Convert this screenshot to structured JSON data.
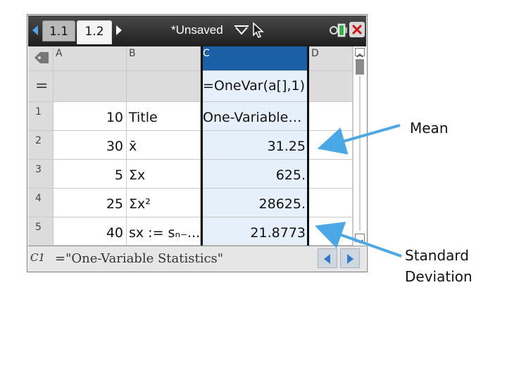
{
  "topbar": {
    "tabs": [
      {
        "label": "1.1"
      },
      {
        "label": "1.2"
      }
    ],
    "document_title": "*Unsaved"
  },
  "grid": {
    "columns": [
      "A",
      "B",
      "C",
      "D"
    ],
    "formula_row": {
      "marker": "=",
      "c_formula": "=OneVar(a[],1)"
    },
    "rows": [
      {
        "num": "1",
        "a": "10",
        "b": "Title",
        "c": "One-Variable…"
      },
      {
        "num": "2",
        "a": "30",
        "b": "x̄",
        "c": "31.25"
      },
      {
        "num": "3",
        "a": "5",
        "b": "Σx",
        "c": "625."
      },
      {
        "num": "4",
        "a": "25",
        "b": "Σx²",
        "c": "28625."
      },
      {
        "num": "5",
        "a": "40",
        "b": "sx := sₙ₋...",
        "c": "21.8773"
      }
    ]
  },
  "entry_line": {
    "cell_ref": "C1",
    "value": "=\"One-Variable Statistics\""
  },
  "annotations": {
    "mean": "Mean",
    "sd_line1": "Standard",
    "sd_line2": "Deviation"
  },
  "colors": {
    "accent_blue": "#1b5fa6",
    "arrow_blue": "#4aa8e6",
    "selection_fill": "#e6f0fa"
  }
}
